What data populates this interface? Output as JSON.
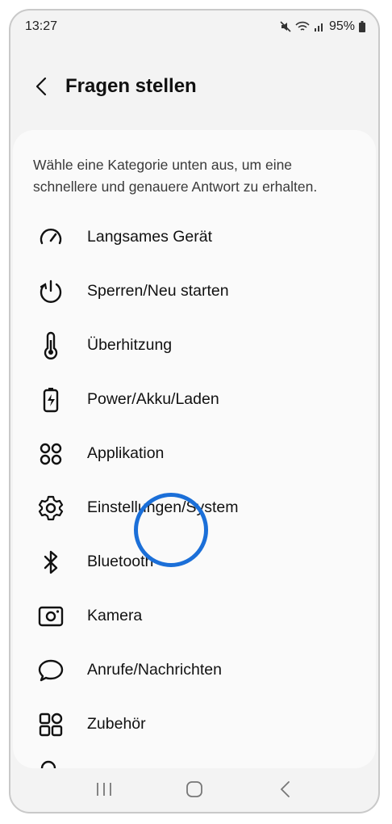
{
  "status_bar": {
    "time": "13:27",
    "battery": "95%"
  },
  "header": {
    "title": "Fragen stellen"
  },
  "intro_text": "Wähle eine Kategorie unten aus, um eine schnellere und genauere Antwort zu erhalten.",
  "categories": [
    {
      "label": "Langsames Gerät",
      "icon": "speedometer-icon"
    },
    {
      "label": "Sperren/Neu starten",
      "icon": "power-restart-icon"
    },
    {
      "label": "Überhitzung",
      "icon": "thermometer-icon"
    },
    {
      "label": "Power/Akku/Laden",
      "icon": "battery-charging-icon"
    },
    {
      "label": "Applikation",
      "icon": "apps-grid-icon"
    },
    {
      "label": "Einstellungen/System",
      "icon": "gear-icon"
    },
    {
      "label": "Bluetooth",
      "icon": "bluetooth-icon"
    },
    {
      "label": "Kamera",
      "icon": "camera-icon"
    },
    {
      "label": "Anrufe/Nachrichten",
      "icon": "chat-bubble-icon"
    },
    {
      "label": "Zubehör",
      "icon": "accessories-icon"
    }
  ],
  "colors": {
    "highlight_ring": "#1b6fd8",
    "background": "#f3f3f3",
    "card": "#fafafa"
  }
}
